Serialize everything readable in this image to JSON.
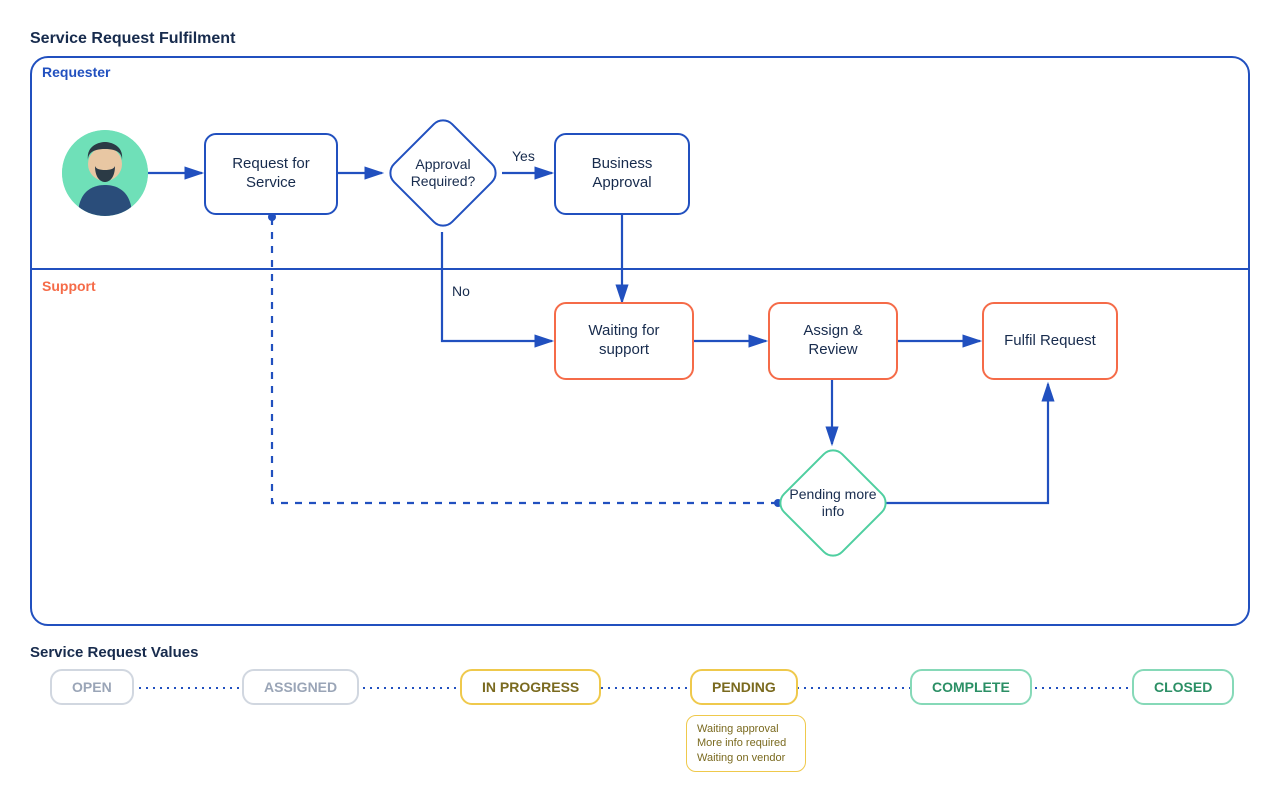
{
  "title": "Service Request Fulfilment",
  "lanes": {
    "requester": "Requester",
    "support": "Support"
  },
  "nodes": {
    "request_for_service": "Request for\nService",
    "approval_required": "Approval\nRequired?",
    "business_approval": "Business\nApproval",
    "waiting_for_support": "Waiting for\nsupport",
    "assign_review": "Assign &\nReview",
    "fulfil_request": "Fulfil Request",
    "pending_more_info": "Pending\nmore\ninfo"
  },
  "edge_labels": {
    "yes": "Yes",
    "no": "No"
  },
  "values_title": "Service Request Values",
  "values": {
    "open": "OPEN",
    "assigned": "ASSIGNED",
    "in_progress": "IN PROGRESS",
    "pending": "PENDING",
    "complete": "COMPLETE",
    "closed": "CLOSED"
  },
  "pending_sub": "Waiting approval\nMore info required\nWaiting on vendor",
  "colors": {
    "blue": "#2150bf",
    "orange": "#f56b48",
    "green": "#4fcfa0",
    "grey": "#d1d7e0",
    "yellow": "#efc94c"
  }
}
